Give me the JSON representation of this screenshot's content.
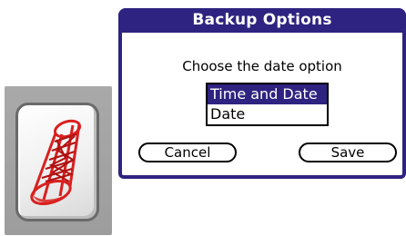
{
  "dialog": {
    "title": "Backup Options",
    "prompt": "Choose the date option",
    "options": [
      {
        "label": "Time and Date",
        "selected": true
      },
      {
        "label": "Date",
        "selected": false
      }
    ],
    "buttons": {
      "cancel": "Cancel",
      "save": "Save"
    }
  },
  "app_icon": {
    "icon": "backup-app-icon",
    "accent_color": "#d9201f"
  },
  "colors": {
    "title_bar": "#2e2380",
    "selection": "#2e2380"
  }
}
